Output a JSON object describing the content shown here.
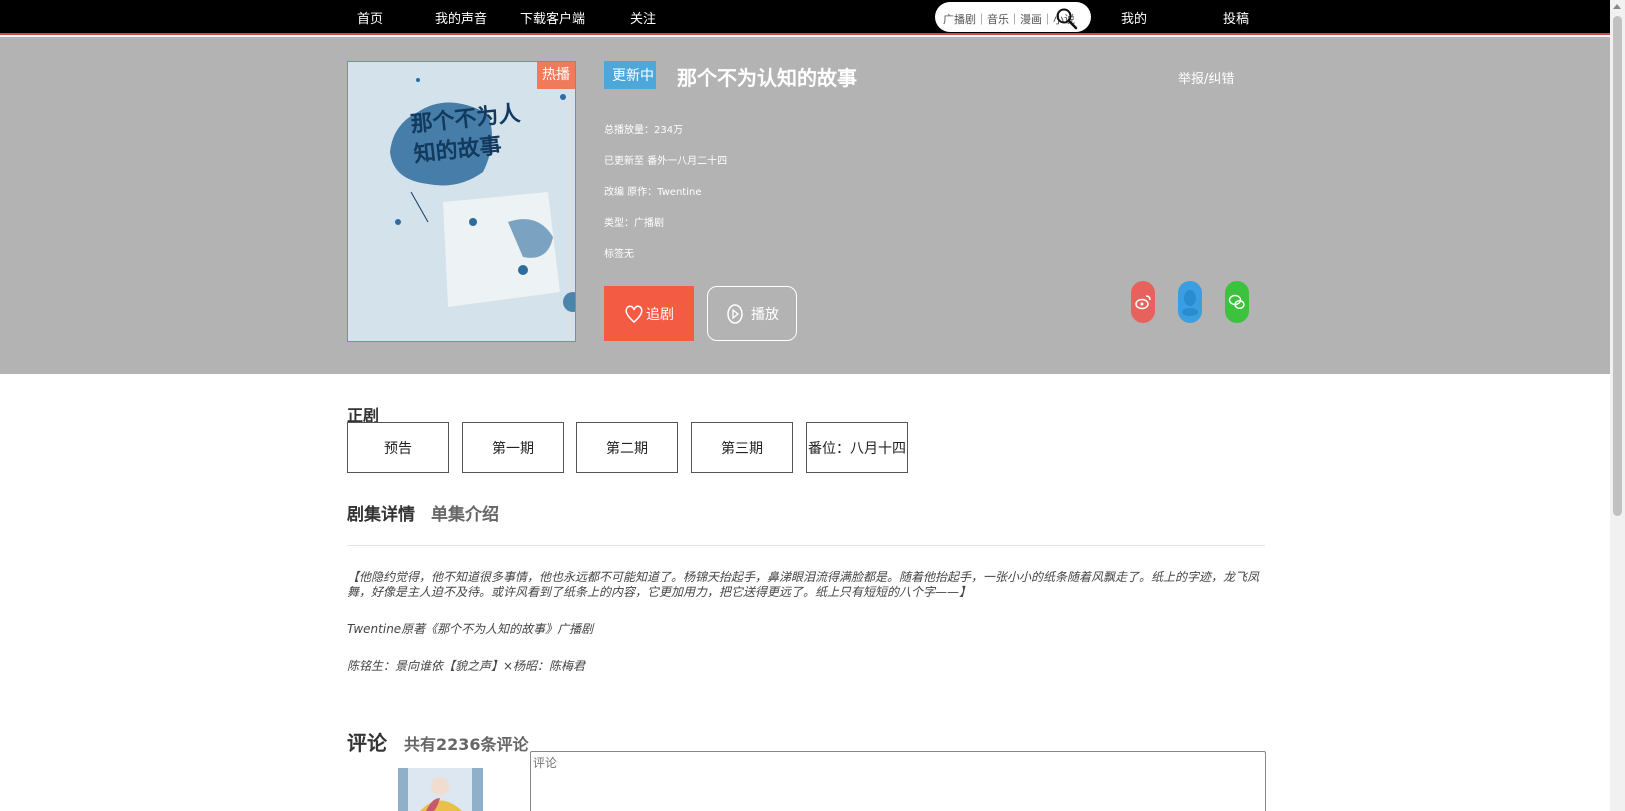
{
  "nav": {
    "home": "首页",
    "my_voice": "我的声音",
    "download": "下载客户端",
    "follow": "关注",
    "mine": "我的",
    "submit": "投稿"
  },
  "search": {
    "categories": "广播剧｜音乐｜漫画｜小说"
  },
  "show": {
    "badge_hot": "热播",
    "status": "更新中",
    "title": "那个不为认知的故事",
    "report": "举报/纠错",
    "play_count": "总播放量：234万",
    "updated_to": "已更新至 番外一八月二十四",
    "adaptation": "改编 原作：Twentine",
    "type": "类型：广播剧",
    "tags": "标签无",
    "follow_label": "追剧",
    "play_label": "播放",
    "cover_title": "那个不为人知的故事"
  },
  "episodes": {
    "section": "正剧",
    "items": [
      "预告",
      "第一期",
      "第二期",
      "第三期",
      "番位：八月十四"
    ]
  },
  "tabs": {
    "details": "剧集详情",
    "single": "单集介绍"
  },
  "description": {
    "p1": "【他隐约觉得，他不知道很多事情，他也永远都不可能知道了。杨锦天抬起手，鼻涕眼泪流得满脸都是。随着他抬起手，一张小小的纸条随着风飘走了。纸上的字迹，龙飞凤舞，好像是主人迫不及待。或许风看到了纸条上的内容，它更加用力，把它送得更远了。纸上只有短短的八个字——】",
    "p2": "Twentine原著《那个不为人知的故事》广播剧",
    "p3": "陈铭生：景向谁依【貌之声】×杨昭：陈梅君"
  },
  "comments": {
    "heading": "评论",
    "count": "共有2236条评论",
    "placeholder": "评论"
  },
  "colors": {
    "nav_bg": "#000000",
    "hero_bg": "#b3b3b3",
    "accent_red": "#f35b42",
    "status_blue": "#4da7d8",
    "weibo": "#e8625d",
    "qq": "#3a9ee0",
    "wechat": "#3cc23c"
  },
  "icons": [
    "search-icon",
    "heart-icon",
    "play-icon",
    "weibo-icon",
    "qq-icon",
    "wechat-icon"
  ]
}
